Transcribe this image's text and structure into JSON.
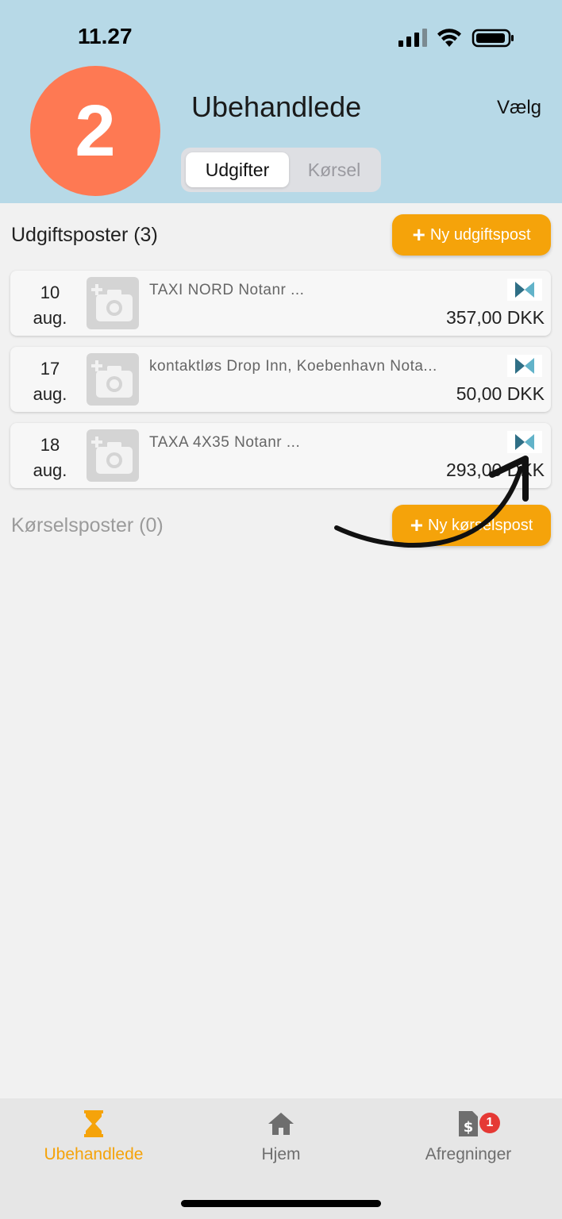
{
  "status_bar": {
    "time": "11.27"
  },
  "header": {
    "step_number": "2",
    "title": "Ubehandlede",
    "select_label": "Vælg",
    "segments": [
      {
        "label": "Udgifter",
        "active": true
      },
      {
        "label": "Kørsel",
        "active": false
      }
    ]
  },
  "expenses_section": {
    "title": "Udgiftsposter (3)",
    "add_button_label": "Ny udgiftspost",
    "items": [
      {
        "day": "10",
        "month": "aug.",
        "description": "TAXI NORD Notanr ...",
        "amount": "357,00 DKK"
      },
      {
        "day": "17",
        "month": "aug.",
        "description": "kontaktløs Drop Inn, Koebenhavn Nota...",
        "amount": "50,00 DKK"
      },
      {
        "day": "18",
        "month": "aug.",
        "description": "TAXA 4X35 Notanr ...",
        "amount": "293,00 DKK"
      }
    ]
  },
  "mileage_section": {
    "title": "Kørselsposter (0)",
    "add_button_label": "Ny kørselspost"
  },
  "tabbar": {
    "tabs": [
      {
        "label": "Ubehandlede",
        "icon": "hourglass-icon",
        "active": true
      },
      {
        "label": "Hjem",
        "icon": "home-icon",
        "active": false
      },
      {
        "label": "Afregninger",
        "icon": "receipt-dollar-icon",
        "active": false,
        "badge": "1"
      }
    ]
  },
  "colors": {
    "header_bg": "#b7d9e7",
    "accent": "#f5a30a",
    "step_badge": "#fe7953",
    "notification": "#e53935"
  }
}
